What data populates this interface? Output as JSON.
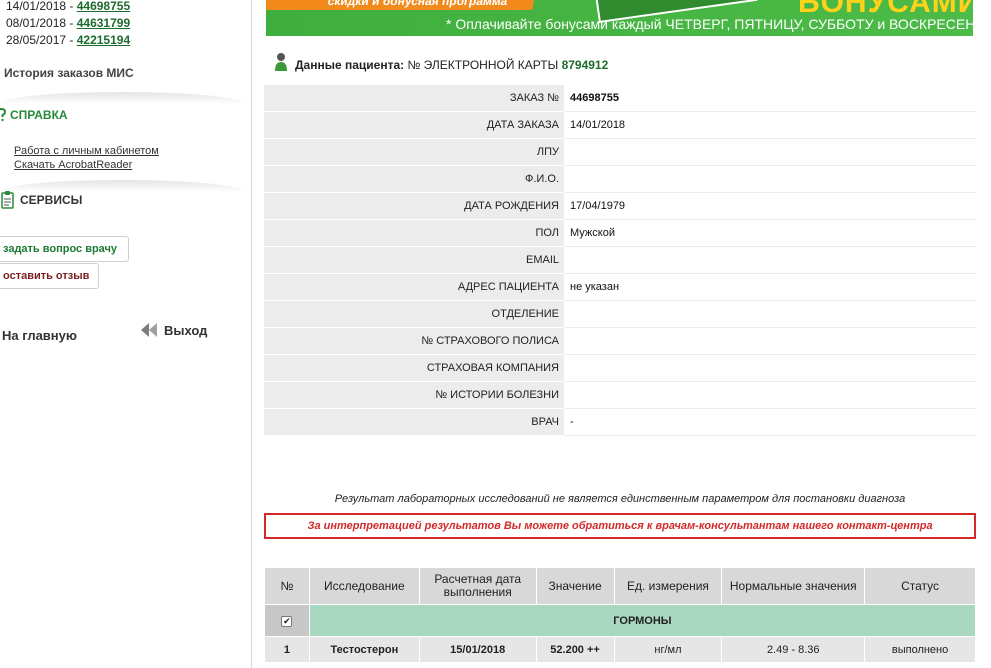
{
  "sidebar": {
    "orders": [
      {
        "date": "14/01/2018",
        "sep": " - ",
        "number": "44698755"
      },
      {
        "date": "08/01/2018",
        "sep": " - ",
        "number": "44631799"
      },
      {
        "date": "28/05/2017",
        "sep": " - ",
        "number": "42215194"
      }
    ],
    "mis_history": "История заказов МИС",
    "help_title": "СПРАВКА",
    "help_links": [
      "Работа с личным кабинетом",
      "Скачать AcrobatReader"
    ],
    "services_title": "СЕРВИСЫ",
    "ask_doctor": "задать вопрос врачу",
    "leave_review": "оставить отзыв",
    "home": "На главную",
    "exit": "Выход"
  },
  "banner": {
    "promo_text": "* Оплачивайте бонусами каждый ЧЕТВЕРГ, ПЯТНИЦУ, СУББОТУ и ВОСКРЕСЕНЬЕ »",
    "top_left_text": "скидки и бонусная программа",
    "big_text": "БОНУСАМИ"
  },
  "patient": {
    "heading_label": "Данные пациента:",
    "card_label": "№ ЭЛЕКТРОННОЙ КАРТЫ",
    "card_number": "8794912",
    "fields": [
      {
        "key": "ЗАКАЗ №",
        "value": "44698755"
      },
      {
        "key": "ДАТА ЗАКАЗА",
        "value": "14/01/2018"
      },
      {
        "key": "ЛПУ",
        "value": ""
      },
      {
        "key": "Ф.И.О.",
        "value": ""
      },
      {
        "key": "ДАТА РОЖДЕНИЯ",
        "value": "17/04/1979"
      },
      {
        "key": "ПОЛ",
        "value": "Мужской"
      },
      {
        "key": "EMAIL",
        "value": ""
      },
      {
        "key": "АДРЕС ПАЦИЕНТА",
        "value": "не указан"
      },
      {
        "key": "ОТДЕЛЕНИЕ",
        "value": ""
      },
      {
        "key": "№ СТРАХОВОГО ПОЛИСА",
        "value": ""
      },
      {
        "key": "СТРАХОВАЯ КОМПАНИЯ",
        "value": ""
      },
      {
        "key": "№ ИСТОРИИ БОЛЕЗНИ",
        "value": ""
      },
      {
        "key": "ВРАЧ",
        "value": "-"
      }
    ]
  },
  "notes": {
    "disclaimer": "Результат лабораторных исследований не является единственным параметром для постановки диагноза",
    "contact": "За интерпретацией результатов Вы можете обратиться к врачам-консультантам нашего контакт-центра"
  },
  "results": {
    "headers": [
      "№",
      "Исследование",
      "Расчетная дата выполнения",
      "Значение",
      "Ед. измерения",
      "Нормальные значения",
      "Статус"
    ],
    "group": "ГОРМОНЫ",
    "group_check": "✔",
    "rows": [
      {
        "n": "1",
        "test": "Тестостерон",
        "date": "15/01/2018",
        "value": "52.200 ++",
        "unit": "нг/мл",
        "norm": "2.49 - 8.36",
        "status": "выполнено"
      }
    ]
  },
  "colors": {
    "brand_green": "#1d6b2c",
    "accent_green": "#2a8a3c",
    "alert_red": "#d22a2a",
    "group_row": "#a8d8c0"
  },
  "icons": [
    "person-icon",
    "help-icon",
    "clipboard-icon",
    "back-arrow-icon",
    "checkbox-icon"
  ]
}
